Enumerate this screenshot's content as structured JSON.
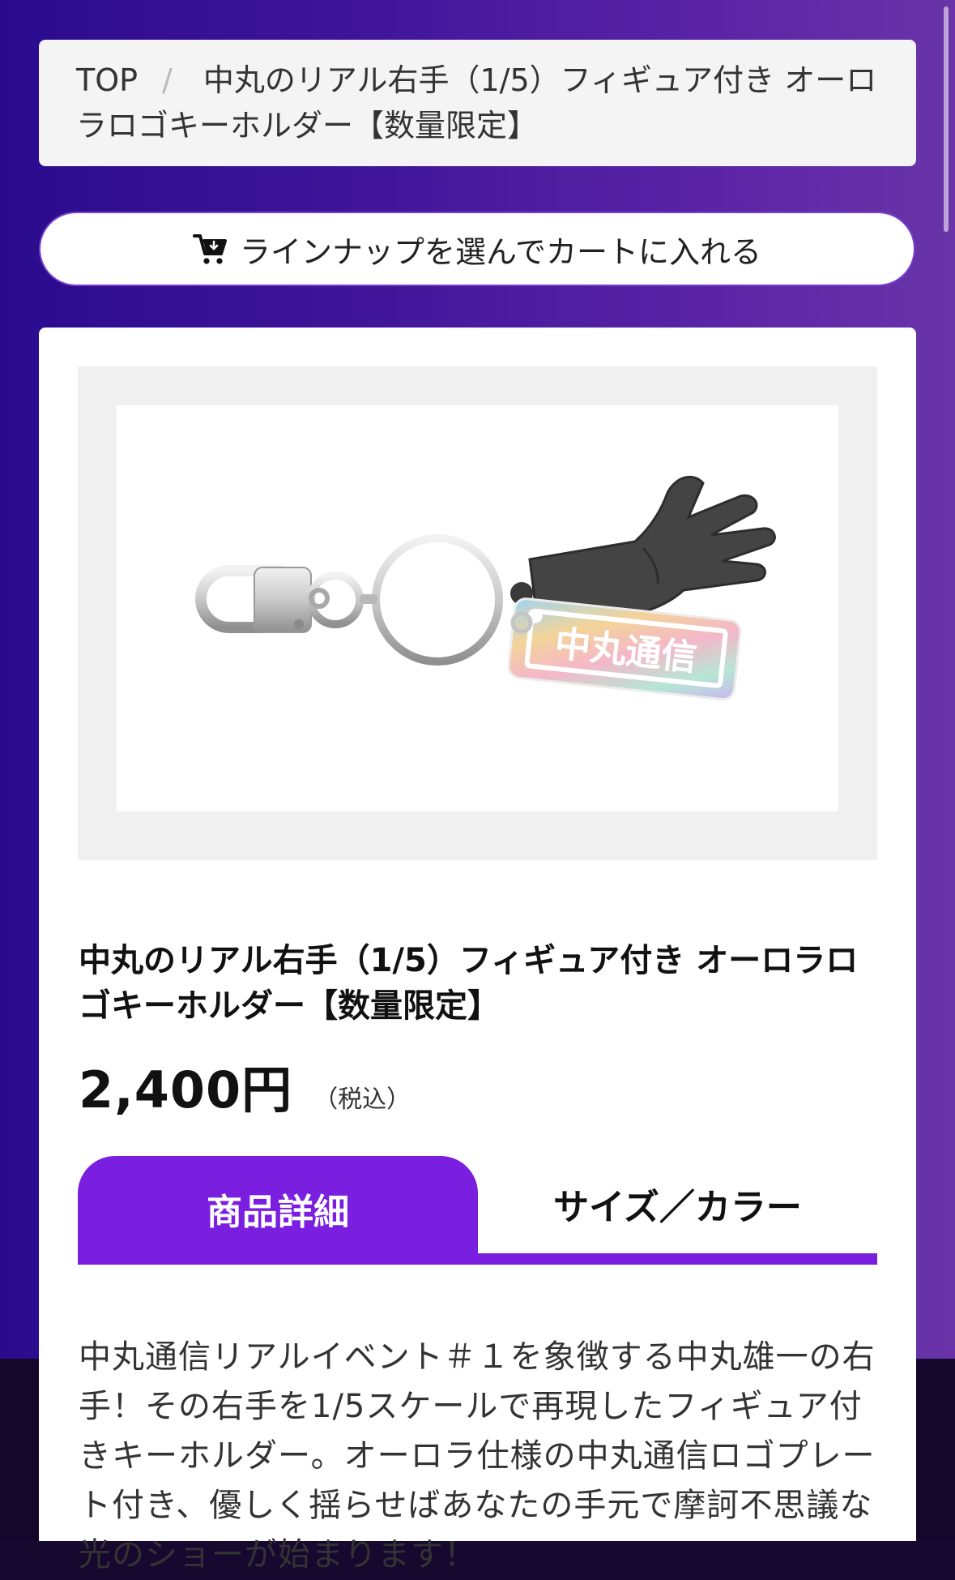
{
  "breadcrumb": {
    "top_label": "TOP",
    "separator": "/",
    "current": "中丸のリアル右手（1/5）フィギュア付き オーロラロゴキーホルダー【数量限定】"
  },
  "cart_button": {
    "label": "ラインナップを選んでカートに入れる",
    "icon": "cart-icon"
  },
  "product": {
    "image_alt_icon": "keychain-hand-figure",
    "plate_text": "中丸通信",
    "title": "中丸のリアル右手（1/5）フィギュア付き オーロラロゴキーホルダー【数量限定】",
    "price": "2,400円",
    "tax_note": "（税込）"
  },
  "tabs": {
    "items": [
      {
        "label": "商品詳細",
        "active": true
      },
      {
        "label": "サイズ／カラー",
        "active": false
      }
    ]
  },
  "description": "中丸通信リアルイベント＃１を象徴する中丸雄一の右手！その右手を1/5スケールで再現したフィギュア付きキーホルダー。オーロラ仕様の中丸通信ロゴプレート付き、優しく揺らせばあなたの手元で摩訶不思議な光のショーが始まります！",
  "colors": {
    "accent": "#7a1ee0",
    "background_gradient_start": "#2a0b8e",
    "background_gradient_end": "#6a34a8"
  }
}
